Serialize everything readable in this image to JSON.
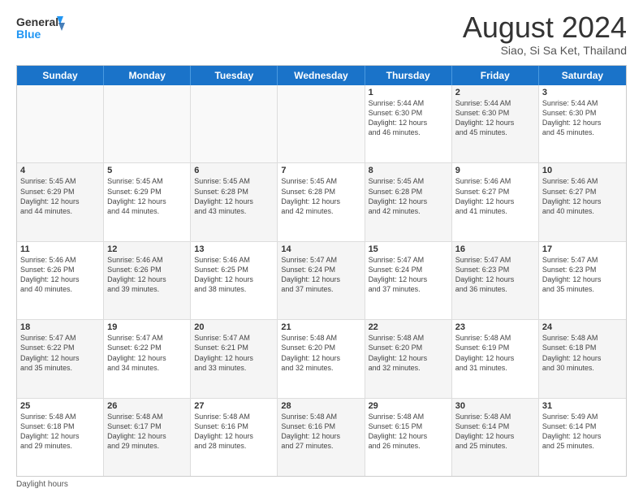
{
  "header": {
    "logo_line1": "General",
    "logo_line2": "Blue",
    "month_title": "August 2024",
    "subtitle": "Siao, Si Sa Ket, Thailand"
  },
  "days_of_week": [
    "Sunday",
    "Monday",
    "Tuesday",
    "Wednesday",
    "Thursday",
    "Friday",
    "Saturday"
  ],
  "weeks": [
    [
      {
        "day": "",
        "info": "",
        "empty": true
      },
      {
        "day": "",
        "info": "",
        "empty": true
      },
      {
        "day": "",
        "info": "",
        "empty": true
      },
      {
        "day": "",
        "info": "",
        "empty": true
      },
      {
        "day": "1",
        "info": "Sunrise: 5:44 AM\nSunset: 6:30 PM\nDaylight: 12 hours\nand 46 minutes.",
        "shaded": false
      },
      {
        "day": "2",
        "info": "Sunrise: 5:44 AM\nSunset: 6:30 PM\nDaylight: 12 hours\nand 45 minutes.",
        "shaded": true
      },
      {
        "day": "3",
        "info": "Sunrise: 5:44 AM\nSunset: 6:30 PM\nDaylight: 12 hours\nand 45 minutes.",
        "shaded": false
      }
    ],
    [
      {
        "day": "4",
        "info": "Sunrise: 5:45 AM\nSunset: 6:29 PM\nDaylight: 12 hours\nand 44 minutes.",
        "shaded": true
      },
      {
        "day": "5",
        "info": "Sunrise: 5:45 AM\nSunset: 6:29 PM\nDaylight: 12 hours\nand 44 minutes.",
        "shaded": false
      },
      {
        "day": "6",
        "info": "Sunrise: 5:45 AM\nSunset: 6:28 PM\nDaylight: 12 hours\nand 43 minutes.",
        "shaded": true
      },
      {
        "day": "7",
        "info": "Sunrise: 5:45 AM\nSunset: 6:28 PM\nDaylight: 12 hours\nand 42 minutes.",
        "shaded": false
      },
      {
        "day": "8",
        "info": "Sunrise: 5:45 AM\nSunset: 6:28 PM\nDaylight: 12 hours\nand 42 minutes.",
        "shaded": true
      },
      {
        "day": "9",
        "info": "Sunrise: 5:46 AM\nSunset: 6:27 PM\nDaylight: 12 hours\nand 41 minutes.",
        "shaded": false
      },
      {
        "day": "10",
        "info": "Sunrise: 5:46 AM\nSunset: 6:27 PM\nDaylight: 12 hours\nand 40 minutes.",
        "shaded": true
      }
    ],
    [
      {
        "day": "11",
        "info": "Sunrise: 5:46 AM\nSunset: 6:26 PM\nDaylight: 12 hours\nand 40 minutes.",
        "shaded": false
      },
      {
        "day": "12",
        "info": "Sunrise: 5:46 AM\nSunset: 6:26 PM\nDaylight: 12 hours\nand 39 minutes.",
        "shaded": true
      },
      {
        "day": "13",
        "info": "Sunrise: 5:46 AM\nSunset: 6:25 PM\nDaylight: 12 hours\nand 38 minutes.",
        "shaded": false
      },
      {
        "day": "14",
        "info": "Sunrise: 5:47 AM\nSunset: 6:24 PM\nDaylight: 12 hours\nand 37 minutes.",
        "shaded": true
      },
      {
        "day": "15",
        "info": "Sunrise: 5:47 AM\nSunset: 6:24 PM\nDaylight: 12 hours\nand 37 minutes.",
        "shaded": false
      },
      {
        "day": "16",
        "info": "Sunrise: 5:47 AM\nSunset: 6:23 PM\nDaylight: 12 hours\nand 36 minutes.",
        "shaded": true
      },
      {
        "day": "17",
        "info": "Sunrise: 5:47 AM\nSunset: 6:23 PM\nDaylight: 12 hours\nand 35 minutes.",
        "shaded": false
      }
    ],
    [
      {
        "day": "18",
        "info": "Sunrise: 5:47 AM\nSunset: 6:22 PM\nDaylight: 12 hours\nand 35 minutes.",
        "shaded": true
      },
      {
        "day": "19",
        "info": "Sunrise: 5:47 AM\nSunset: 6:22 PM\nDaylight: 12 hours\nand 34 minutes.",
        "shaded": false
      },
      {
        "day": "20",
        "info": "Sunrise: 5:47 AM\nSunset: 6:21 PM\nDaylight: 12 hours\nand 33 minutes.",
        "shaded": true
      },
      {
        "day": "21",
        "info": "Sunrise: 5:48 AM\nSunset: 6:20 PM\nDaylight: 12 hours\nand 32 minutes.",
        "shaded": false
      },
      {
        "day": "22",
        "info": "Sunrise: 5:48 AM\nSunset: 6:20 PM\nDaylight: 12 hours\nand 32 minutes.",
        "shaded": true
      },
      {
        "day": "23",
        "info": "Sunrise: 5:48 AM\nSunset: 6:19 PM\nDaylight: 12 hours\nand 31 minutes.",
        "shaded": false
      },
      {
        "day": "24",
        "info": "Sunrise: 5:48 AM\nSunset: 6:18 PM\nDaylight: 12 hours\nand 30 minutes.",
        "shaded": true
      }
    ],
    [
      {
        "day": "25",
        "info": "Sunrise: 5:48 AM\nSunset: 6:18 PM\nDaylight: 12 hours\nand 29 minutes.",
        "shaded": false
      },
      {
        "day": "26",
        "info": "Sunrise: 5:48 AM\nSunset: 6:17 PM\nDaylight: 12 hours\nand 29 minutes.",
        "shaded": true
      },
      {
        "day": "27",
        "info": "Sunrise: 5:48 AM\nSunset: 6:16 PM\nDaylight: 12 hours\nand 28 minutes.",
        "shaded": false
      },
      {
        "day": "28",
        "info": "Sunrise: 5:48 AM\nSunset: 6:16 PM\nDaylight: 12 hours\nand 27 minutes.",
        "shaded": true
      },
      {
        "day": "29",
        "info": "Sunrise: 5:48 AM\nSunset: 6:15 PM\nDaylight: 12 hours\nand 26 minutes.",
        "shaded": false
      },
      {
        "day": "30",
        "info": "Sunrise: 5:48 AM\nSunset: 6:14 PM\nDaylight: 12 hours\nand 25 minutes.",
        "shaded": true
      },
      {
        "day": "31",
        "info": "Sunrise: 5:49 AM\nSunset: 6:14 PM\nDaylight: 12 hours\nand 25 minutes.",
        "shaded": false
      }
    ]
  ],
  "footer": {
    "daylight_label": "Daylight hours"
  }
}
